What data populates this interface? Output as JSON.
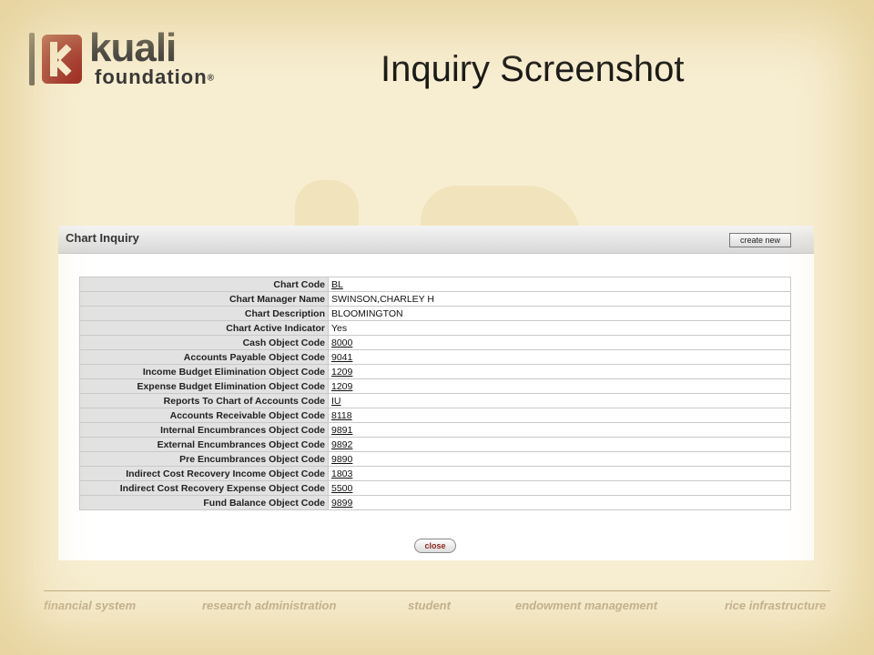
{
  "logo": {
    "word1": "kuali",
    "word2": "foundation",
    "reg": "®"
  },
  "slide_title": "Inquiry Screenshot",
  "panel": {
    "title": "Chart Inquiry",
    "create_label": "create new",
    "close_label": "close",
    "rows": [
      {
        "label": "Chart Code",
        "value": "BL",
        "link": true
      },
      {
        "label": "Chart Manager Name",
        "value": "SWINSON,CHARLEY H",
        "link": false
      },
      {
        "label": "Chart Description",
        "value": "BLOOMINGTON",
        "link": false
      },
      {
        "label": "Chart Active Indicator",
        "value": "Yes",
        "link": false
      },
      {
        "label": "Cash Object Code",
        "value": "8000",
        "link": true
      },
      {
        "label": "Accounts Payable Object Code",
        "value": "9041",
        "link": true
      },
      {
        "label": "Income Budget Elimination Object Code",
        "value": "1209",
        "link": true
      },
      {
        "label": "Expense Budget Elimination Object Code",
        "value": "1209",
        "link": true
      },
      {
        "label": "Reports To Chart of Accounts Code",
        "value": "IU",
        "link": true
      },
      {
        "label": "Accounts Receivable Object Code",
        "value": "8118",
        "link": true
      },
      {
        "label": "Internal Encumbrances Object Code",
        "value": "9891",
        "link": true
      },
      {
        "label": "External Encumbrances Object Code",
        "value": "9892",
        "link": true
      },
      {
        "label": "Pre Encumbrances Object Code",
        "value": "9890",
        "link": true
      },
      {
        "label": "Indirect Cost Recovery Income Object Code",
        "value": "1803",
        "link": true
      },
      {
        "label": "Indirect Cost Recovery Expense Object Code",
        "value": "5500",
        "link": true
      },
      {
        "label": "Fund Balance Object Code",
        "value": "9899",
        "link": true
      }
    ]
  },
  "footer": [
    "financial system",
    "research administration",
    "student",
    "endowment management",
    "rice infrastructure"
  ]
}
